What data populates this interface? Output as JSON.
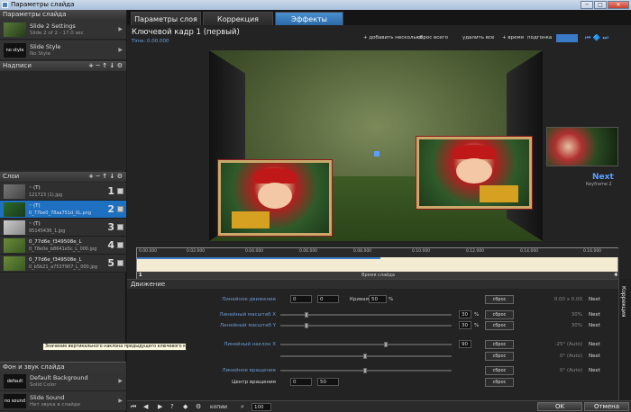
{
  "window": {
    "title": "Параметры слайда",
    "btn_min": "─",
    "btn_max": "□",
    "btn_close": "✕"
  },
  "left": {
    "slide_params_header": "Параметры слайда",
    "slides": [
      {
        "thumb": "",
        "name": "Slide 2 Settings",
        "sub": "Slide 2 of 2 - 17.0 sec"
      },
      {
        "thumb": "no style",
        "name": "Slide Style",
        "sub": "No Style"
      }
    ],
    "captions_header": "Надписи",
    "layers_header": "Слои",
    "header_tools": "+ ─ ↑ ↓ ⚙",
    "layers": [
      {
        "name": "◦ (T)",
        "sub": "121723 (1).jpg",
        "num": "1"
      },
      {
        "name": "◦ (T)",
        "sub": "0_77be0_78aa751d_XL.png",
        "num": "2"
      },
      {
        "name": "◦ (T)",
        "sub": "95145436_1.jpg",
        "num": "3"
      },
      {
        "name": "0_77d6e_f349508e_L",
        "sub": "0_78e0e_b8641e5c_L_000.jpg",
        "num": "4"
      },
      {
        "name": "0_77d6e_f349508e_L",
        "sub": "0_b5b21_a7537907_L_000.jpg",
        "num": "5"
      }
    ],
    "bg_header": "Фон и звук слайда",
    "bg_items": [
      {
        "thumb": "default",
        "name": "Default Background",
        "sub": "Solid Color"
      },
      {
        "thumb": "no sound",
        "name": "Slide Sound",
        "sub": "Нет звука в слайде"
      }
    ]
  },
  "tabs": [
    "Параметры слоя",
    "Коррекция",
    "Эффекты"
  ],
  "keyframe": {
    "title": "Ключевой кадр 1 (первый)",
    "time": "Time: 0.00.000"
  },
  "toolbar": {
    "add": "+ добавить  несколько",
    "reset_all": "сброс всего",
    "delete": "удалить все",
    "time_plus": "+ время",
    "fit": "подгонка"
  },
  "next": {
    "label": "Next",
    "sub": "Keyframe 2"
  },
  "timeline": {
    "ticks": [
      "0.00.000",
      "0.02.000",
      "0.04.000",
      "0.06.000",
      "0.08.000",
      "0.10.000",
      "0.12.000",
      "0.14.000",
      "0.16.000"
    ],
    "footer": "Время слайда",
    "marker_start": "1",
    "marker_end": "4"
  },
  "motion": {
    "header": "Движение",
    "side_tab": "Коррекция",
    "rows": [
      {
        "label": "Линейное движение",
        "v1": "0",
        "v2": "0",
        "extra": "Кривая",
        "v3": "50",
        "unit": "%",
        "reset": "сброс",
        "rval": "0.00 x 0.00",
        "rn": "Next"
      },
      {
        "label": "Линейный масштаб X",
        "v1": "",
        "v2": "",
        "extra": "",
        "v3": "30",
        "unit": "%",
        "reset": "сброс",
        "rval": "30%",
        "rn": "Next"
      },
      {
        "label": "Линейный масштаб Y",
        "v1": "",
        "v2": "",
        "extra": "",
        "v3": "30",
        "unit": "%",
        "reset": "сброс",
        "rval": "30%",
        "rn": "Next"
      },
      {
        "label": "Линейный наклон X",
        "v1": "",
        "v2": "",
        "extra": "",
        "v3": "90",
        "unit": "",
        "reset": "сброс",
        "rval": "-25° (Auto)",
        "rn": "Next"
      },
      {
        "label": "",
        "v1": "",
        "v2": "",
        "extra": "",
        "v3": "",
        "unit": "",
        "reset": "сброс",
        "rval": "0° (Auto)",
        "rn": "Next"
      },
      {
        "label": "Линейное вращение",
        "v1": "",
        "v2": "",
        "extra": "",
        "v3": "",
        "unit": "",
        "reset": "сброс",
        "rval": "0° (Auto)",
        "rn": "Next"
      },
      {
        "label": "Центр вращения",
        "v1": "0",
        "v2": "50",
        "extra": "",
        "v3": "",
        "unit": "",
        "reset": "сброс",
        "rval": "",
        "rn": ""
      }
    ],
    "tooltip": "Значение вертикального наклона предыдущего ключевого кадра"
  },
  "bottom": {
    "copy": "копии",
    "zoom": "100",
    "ok": "OK",
    "cancel": "Отмена"
  }
}
